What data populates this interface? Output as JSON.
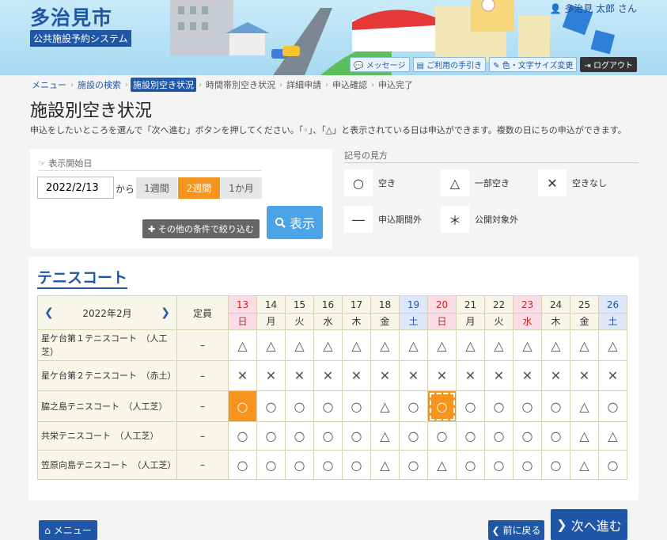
{
  "header": {
    "city": "多治見市",
    "system": "公共施設予約システム",
    "user": "多治見 太郎 さん",
    "buttons": [
      "メッセージ",
      "ご利用の手引き",
      "色・文字サイズ変更",
      "ログアウト"
    ]
  },
  "breadcrumb": [
    "メニュー",
    "施設の検索",
    "施設別空き状況",
    "時間帯別空き状況",
    "詳細申請",
    "申込確認",
    "申込完了"
  ],
  "page": {
    "title": "施設別空き状況",
    "description": "申込をしたいところを選んで「次へ進む」ボタンを押してください。「◦」、「△」と表示されている日は申込ができます。複数の日にちの申込ができます。"
  },
  "search": {
    "label": "表示開始日",
    "date": "2022/2/13",
    "from": "から",
    "periods": [
      "1週間",
      "2週間",
      "1か月"
    ],
    "selected_period": "2週間",
    "filter_label": "その他の条件で絞り込む",
    "show_label": "表示"
  },
  "legend": {
    "title": "記号の見方",
    "items": [
      {
        "symbol": "○",
        "label": "空き"
      },
      {
        "symbol": "△",
        "label": "一部空き"
      },
      {
        "symbol": "✕",
        "label": "空きなし"
      },
      {
        "symbol": "―",
        "label": "申込期間外"
      },
      {
        "symbol": "＊",
        "label": "公開対象外"
      }
    ]
  },
  "facility": {
    "title": "テニスコート",
    "month": "2022年2月",
    "capacity_label": "定員",
    "days": [
      {
        "d": "13",
        "w": "日",
        "t": "sun"
      },
      {
        "d": "14",
        "w": "月",
        "t": "wk"
      },
      {
        "d": "15",
        "w": "火",
        "t": "wk"
      },
      {
        "d": "16",
        "w": "水",
        "t": "wk"
      },
      {
        "d": "17",
        "w": "木",
        "t": "wk"
      },
      {
        "d": "18",
        "w": "金",
        "t": "wk"
      },
      {
        "d": "19",
        "w": "土",
        "t": "sat"
      },
      {
        "d": "20",
        "w": "日",
        "t": "sun"
      },
      {
        "d": "21",
        "w": "月",
        "t": "wk"
      },
      {
        "d": "22",
        "w": "火",
        "t": "wk"
      },
      {
        "d": "23",
        "w": "水",
        "t": "sun"
      },
      {
        "d": "24",
        "w": "木",
        "t": "wk"
      },
      {
        "d": "25",
        "w": "金",
        "t": "wk"
      },
      {
        "d": "26",
        "w": "土",
        "t": "sat"
      }
    ],
    "rows": [
      {
        "name": "星ケ台第１テニスコート　（人工芝）",
        "cap": "–",
        "cells": [
          "△",
          "△",
          "△",
          "△",
          "△",
          "△",
          "△",
          "△",
          "△",
          "△",
          "△",
          "△",
          "△",
          "△"
        ],
        "sel": []
      },
      {
        "name": "星ケ台第２テニスコート　（赤土）",
        "cap": "–",
        "cells": [
          "✕",
          "✕",
          "✕",
          "✕",
          "✕",
          "✕",
          "✕",
          "✕",
          "✕",
          "✕",
          "✕",
          "✕",
          "✕",
          "✕"
        ],
        "sel": []
      },
      {
        "name": "脇之島テニスコート　（人工芝）",
        "cap": "–",
        "cells": [
          "○",
          "○",
          "○",
          "○",
          "○",
          "△",
          "○",
          "○",
          "○",
          "○",
          "○",
          "○",
          "△",
          "○"
        ],
        "sel": [
          0,
          7
        ]
      },
      {
        "name": "共栄テニスコート　（人工芝）",
        "cap": "–",
        "cells": [
          "○",
          "○",
          "○",
          "○",
          "○",
          "△",
          "○",
          "○",
          "○",
          "○",
          "○",
          "○",
          "△",
          "△"
        ],
        "sel": []
      },
      {
        "name": "笠原向島テニスコート　（人工芝）",
        "cap": "–",
        "cells": [
          "○",
          "○",
          "○",
          "○",
          "○",
          "△",
          "○",
          "△",
          "○",
          "○",
          "○",
          "○",
          "△",
          "○"
        ],
        "sel": []
      }
    ]
  },
  "footer": {
    "menu": "メニュー",
    "back": "前に戻る",
    "next": "次へ進む"
  }
}
